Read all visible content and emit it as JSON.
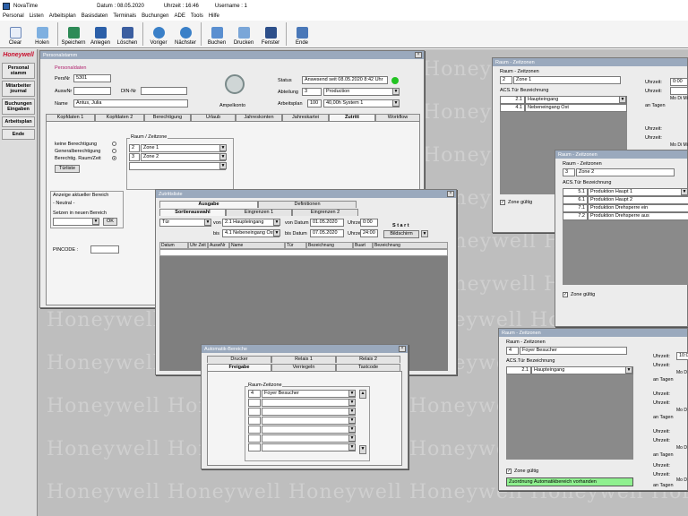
{
  "app": {
    "title": "NovaTime",
    "datum": "Datum : 08.05.2020",
    "uhrzeit": "Uhrzeit : 16:46",
    "username": "Username : 1"
  },
  "menu": [
    "Personal",
    "Listen",
    "Arbeitsplan",
    "Basisdaten",
    "Terminals",
    "Buchungen",
    "ADE",
    "Tools",
    "Hilfe"
  ],
  "toolbar": [
    "Clear",
    "Holen",
    "Speichern",
    "Anlegen",
    "Löschen",
    "Voriger",
    "Nächster",
    "Buchen",
    "Drucken",
    "Fenster",
    "Ende"
  ],
  "sidebar": {
    "logo": "Honeywell",
    "items": [
      "Personal stamm",
      "Mitarbeiter journal",
      "Buchungen Eingaben",
      "Arbeitsplan",
      "Ende"
    ]
  },
  "watermark": "Honeywell",
  "personal": {
    "title": "Personalstamm",
    "section": "Personaldaten",
    "persnr_label": "PersNr",
    "persnr": "5301",
    "ausweis_label": "AuswNr",
    "din_label": "DIN-Nr",
    "name_label": "Name",
    "name": "Antus, Julia",
    "ampel": "Ampelkonto",
    "status_label": "Status",
    "status": "Anwesend seit  08.05.2020  8:42 Uhr",
    "abt_label": "Abteilung",
    "abt_nr": "3",
    "abt": "Production",
    "ap_label": "Arbeitsplan",
    "ap_nr": "100",
    "ap": "40,00h System 1",
    "tabs": [
      "Kopfdaten 1",
      "Kopfdaten 2",
      "Berechtigung",
      "Urlaub",
      "Jahreskonten",
      "Jahreskartei",
      "Zutritt",
      "Workflow"
    ],
    "radios": [
      "keine Berechtigung",
      "Generalberechtigung",
      "Berechtig. Raum/Zeit"
    ],
    "tuerliste": "Türliste",
    "rz_label": "Raum / Zeitzone",
    "rz": [
      {
        "n": "2",
        "z": "Zone 1"
      },
      {
        "n": "3",
        "z": "Zone 2"
      }
    ],
    "anzeige_label": "Anzeige aktueller Bereich",
    "neutral": "- Neutral -",
    "setzen": "Setzen in neuen Bereich",
    "ok": "OK",
    "pincode": "PINCODE :"
  },
  "zl": {
    "title": "Zutrittsliste",
    "tabs1": [
      "Ausgabe",
      "Definitionen"
    ],
    "tabs2": [
      "Sortierauswahl",
      "Eingrenzen 1",
      "Eingrenzen 2"
    ],
    "tuer": "Tür",
    "von": "von",
    "von_val": "2.1 Haupteingang",
    "bis": "bis",
    "bis_val": "4.1 Nebeneingang Ost",
    "vdatum_l": "von Datum",
    "vdatum": "01.05.2020",
    "bdatum_l": "bis Datum",
    "bdatum": "07.05.2020",
    "uhrzeit_l": "Uhrzeit",
    "uv": "0:00",
    "ub": "24:00",
    "start": "S t a r t",
    "bild": "Bildschirm",
    "cols": [
      "Datum",
      "Uhr Zeit",
      "AuswNr",
      "Name",
      "Tür",
      "Bezeichnung",
      "Buart",
      "Bezeichnung"
    ]
  },
  "ab": {
    "title": "Automatik-Bereiche",
    "tabs1": [
      "Drucker",
      "Relais 1",
      "Relais 2"
    ],
    "tabs2": [
      "Freigabe",
      "Verriegeln",
      "Tastcode"
    ],
    "rz_label": "Raum-Zeitzone",
    "nr": "4",
    "zone": "Foyer Besucher"
  },
  "rz1": {
    "title": "Raum - Zeitzonen",
    "label": "Raum - Zeitzonen",
    "nr": "2",
    "zone": "Zone 1",
    "acs": "ACS.Tür  Bezeichnung",
    "rows": [
      {
        "n": "2.1",
        "b": "Haupteingang"
      },
      {
        "n": "4.1",
        "b": "Nebeneingang Ost"
      }
    ],
    "gueltig": "Zone gültig",
    "uhrzeit": "Uhrzeit:",
    "uv": "0:00",
    "tage": "an Tagen",
    "modi": "Mo Di Mi"
  },
  "rz2": {
    "title": "Raum - Zeitzonen",
    "label": "Raum - Zeitzonen",
    "nr": "3",
    "zone": "Zone 2",
    "acs": "ACS.Tür  Bezeichnung",
    "rows": [
      {
        "n": "5.1",
        "b": "Produktion Haupt 1"
      },
      {
        "n": "6.1",
        "b": "Produktion Haupt 2"
      },
      {
        "n": "7.1",
        "b": "Produktion Drehsperre ein"
      },
      {
        "n": "7.2",
        "b": "Produktion Drehsperre aus"
      }
    ],
    "gueltig": "Zone gültig"
  },
  "rz3": {
    "title": "Raum - Zeitzonen",
    "label": "Raum - Zeitzonen",
    "nr": "4",
    "zone": "Foyer Besucher",
    "acs": "ACS.Tür  Bezeichnung",
    "rows": [
      {
        "n": "2.1",
        "b": "Haupteingang"
      }
    ],
    "gueltig": "Zone gültig",
    "auto": "Zuordnung Automatikbereich vorhanden",
    "uhrzeit": "Uhrzeit:",
    "uv": "10:0",
    "tage": "an Tagen",
    "modi": "Mo D"
  },
  "colors": {
    "accent": "#2b5fa8",
    "status_green": "#22c322",
    "honeywell": "#c8102e"
  }
}
